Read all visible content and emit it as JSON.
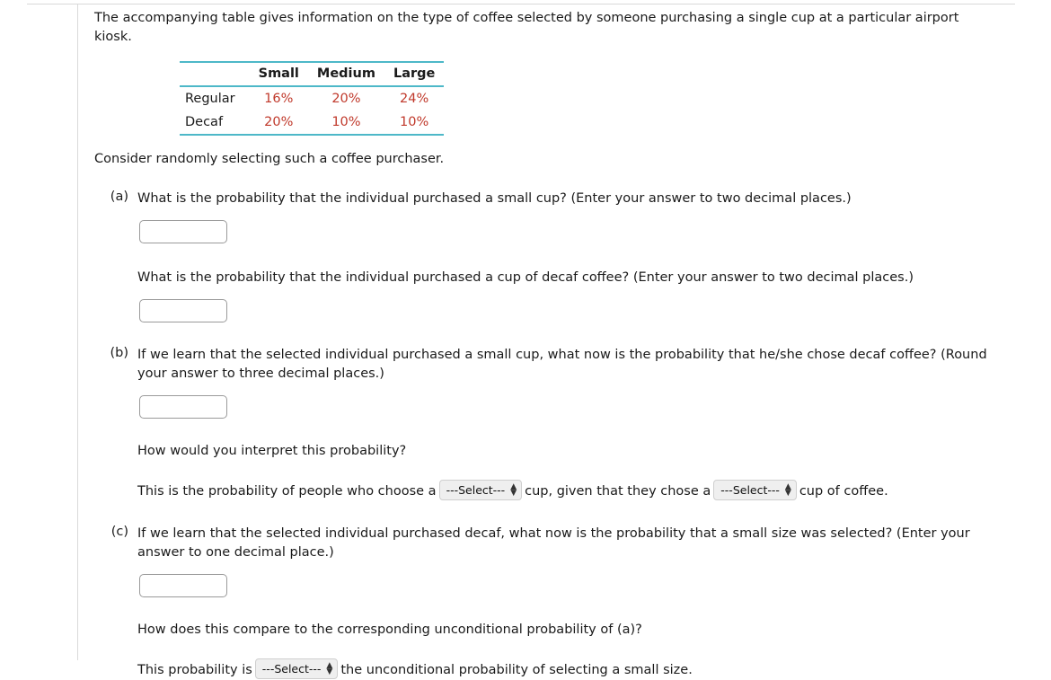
{
  "intro": "The accompanying table gives information on the type of coffee selected by someone purchasing a single cup at a particular airport kiosk.",
  "table": {
    "corner": "",
    "columns": [
      "Small",
      "Medium",
      "Large"
    ],
    "rows": [
      {
        "label": "Regular",
        "values": [
          "16%",
          "20%",
          "24%"
        ]
      },
      {
        "label": "Decaf",
        "values": [
          "20%",
          "10%",
          "10%"
        ]
      }
    ],
    "value_color": "#c0392b",
    "rule_color": "#4db8c8"
  },
  "consider": "Consider randomly selecting such a coffee purchaser.",
  "parts": {
    "a": {
      "label": "(a)",
      "question1": "What is the probability that the individual purchased a small cup? (Enter your answer to two decimal places.)",
      "answer1": "",
      "question2": "What is the probability that the individual purchased a cup of decaf coffee? (Enter your answer to two decimal places.)",
      "answer2": ""
    },
    "b": {
      "label": "(b)",
      "question": "If we learn that the selected individual purchased a small cup, what now is the probability that he/she chose decaf coffee? (Round your answer to three decimal places.)",
      "answer": "",
      "interpret_prompt": "How would you interpret this probability?",
      "interpret_text1": "This is the probability of people who choose a",
      "select1": "---Select---",
      "interpret_text2": "cup, given that they chose a",
      "select2": "---Select---",
      "interpret_text3": "cup of coffee."
    },
    "c": {
      "label": "(c)",
      "question": "If we learn that the selected individual purchased decaf, what now is the probability that a small size was selected? (Enter your answer to one decimal place.)",
      "answer": "",
      "compare_prompt": "How does this compare to the corresponding unconditional probability of (a)?",
      "compare_text1": "This probability is",
      "select": "---Select---",
      "compare_text2": "the unconditional probability of selecting a small size."
    }
  }
}
